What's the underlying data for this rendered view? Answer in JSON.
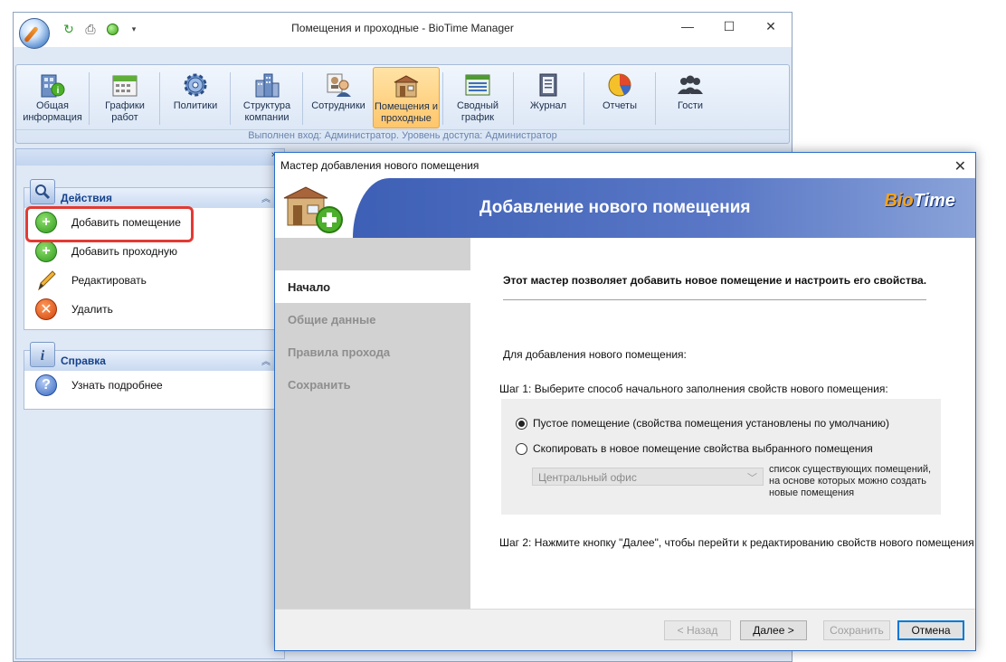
{
  "app": {
    "title": "Помещения и проходные - BioTime Manager",
    "controls": {
      "minimize": "—",
      "maximize": "☐",
      "close": "✕"
    }
  },
  "ribbon": {
    "items": [
      {
        "label": "Общая\nинформация",
        "icon": "info-building-icon"
      },
      {
        "label": "Графики\nработ",
        "icon": "calendar-icon"
      },
      {
        "label": "Политики",
        "icon": "gear-icon"
      },
      {
        "label": "Структура\nкомпании",
        "icon": "company-structure-icon"
      },
      {
        "label": "Сотрудники",
        "icon": "employees-icon"
      },
      {
        "label": "Помещения и\nпроходные",
        "icon": "rooms-icon",
        "active": true
      },
      {
        "label": "Сводный\nграфик",
        "icon": "summary-schedule-icon"
      },
      {
        "label": "Журнал",
        "icon": "journal-icon"
      },
      {
        "label": "Отчеты",
        "icon": "pie-chart-icon"
      },
      {
        "label": "Гости",
        "icon": "guests-icon"
      }
    ],
    "status": "Выполнен вход: Администратор. Уровень доступа: Администратор"
  },
  "left_panel": {
    "collapse_glyph": "»",
    "actions": {
      "title": "Действия",
      "items": [
        {
          "label": "Добавить помещение"
        },
        {
          "label": "Добавить проходную"
        },
        {
          "label": "Редактировать"
        },
        {
          "label": "Удалить"
        }
      ]
    },
    "help": {
      "title": "Справка",
      "items": [
        {
          "label": "Узнать подробнее"
        }
      ]
    }
  },
  "wizard": {
    "title": "Мастер добавления нового помещения",
    "banner_title": "Добавление нового помещения",
    "logo_part1": "Bio",
    "logo_part2": "Time",
    "nav": [
      "Начало",
      "Общие данные",
      "Правила прохода",
      "Сохранить"
    ],
    "intro": "Этот мастер позволяет добавить новое помещение и настроить его свойства.",
    "lead": "Для добавления нового помещения:",
    "step1": "Шаг 1: Выберите способ начального заполнения свойств нового помещения:",
    "option_empty": "Пустое помещение (свойства помещения установлены по умолчанию)",
    "option_copy": "Скопировать в новое помещение свойства выбранного помещения",
    "select_value": "Центральный офис",
    "select_hint": "список существующих помещений, на основе которых можно создать новые помещения",
    "step2": "Шаг 2: Нажмите кнопку \"Далее\", чтобы перейти к редактированию свойств нового помещения",
    "buttons": {
      "back": "< Назад",
      "next": "Далее >",
      "save": "Сохранить",
      "cancel": "Отмена"
    }
  }
}
